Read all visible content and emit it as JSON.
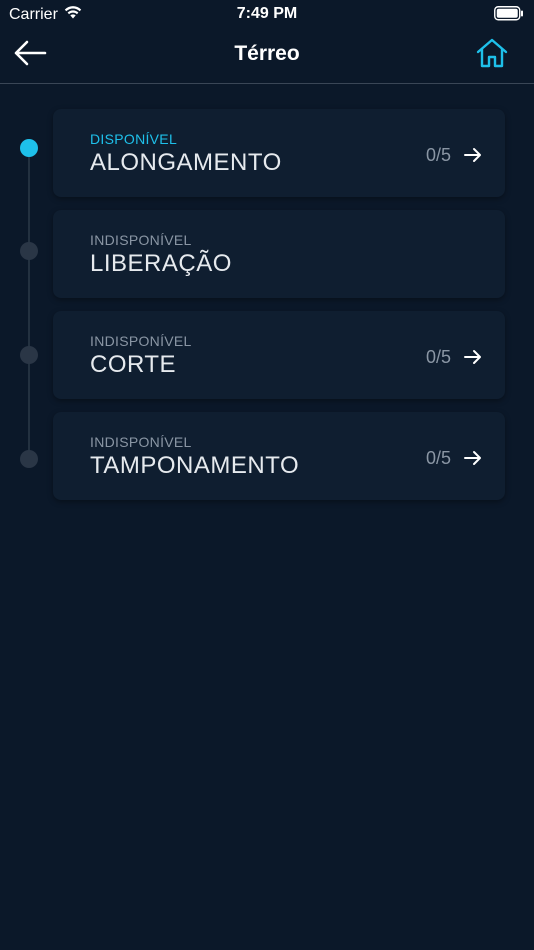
{
  "status_bar": {
    "carrier": "Carrier",
    "time": "7:49 PM"
  },
  "header": {
    "title": "Térreo",
    "back_icon": "arrow-left-icon",
    "home_icon": "home-icon"
  },
  "colors": {
    "background": "#0b1829",
    "card": "#0f1e30",
    "accent": "#1ec0ea",
    "muted": "#8a96a4"
  },
  "steps": [
    {
      "status": "DISPONÍVEL",
      "title": "ALONGAMENTO",
      "count": "0/5",
      "available": true
    },
    {
      "status": "INDISPONÍVEL",
      "title": "LIBERAÇÃO",
      "count": "",
      "available": false
    },
    {
      "status": "INDISPONÍVEL",
      "title": "CORTE",
      "count": "0/5",
      "available": false
    },
    {
      "status": "INDISPONÍVEL",
      "title": "TAMPONAMENTO",
      "count": "0/5",
      "available": false
    }
  ]
}
